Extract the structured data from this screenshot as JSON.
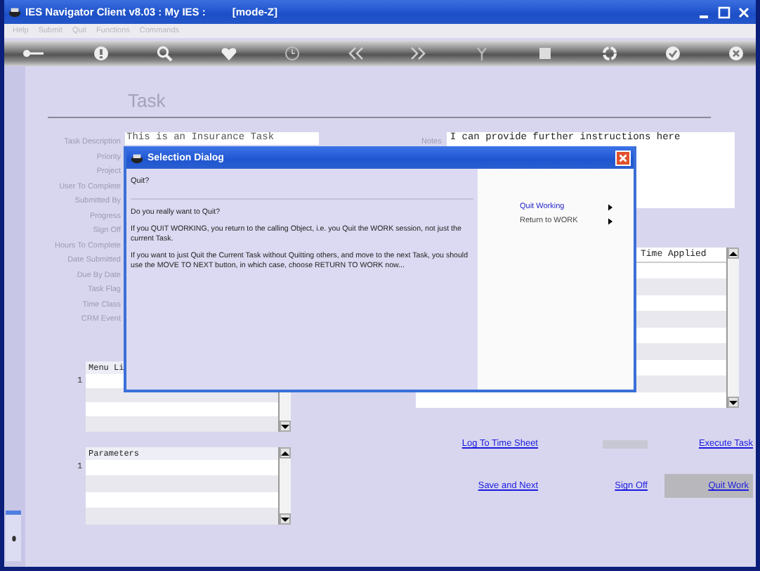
{
  "window": {
    "title": "IES Navigator Client v8.03 : My IES :",
    "mode": "[mode-Z]"
  },
  "menu": [
    {
      "label": "Help"
    },
    {
      "label": "Submit"
    },
    {
      "label": "Quit"
    },
    {
      "label": "Functions"
    },
    {
      "label": "Commands"
    }
  ],
  "form": {
    "heading": "Task",
    "fields": [
      {
        "label": "Task Description",
        "value": "This is an Insurance Task"
      },
      {
        "label": "Priority"
      },
      {
        "label": "Project"
      },
      {
        "label": "User To Complete"
      },
      {
        "label": "Submitted By"
      },
      {
        "label": "Progress"
      },
      {
        "label": "Sign Off"
      },
      {
        "label": "Hours To Complete"
      },
      {
        "label": "Date Submitted"
      },
      {
        "label": "Due By Date"
      },
      {
        "label": "Task Flag"
      },
      {
        "label": "Time Class"
      },
      {
        "label": "CRM Event"
      }
    ],
    "notes": {
      "label": "Notes",
      "value": "I can provide further instructions here"
    },
    "time_table": {
      "column": "Time Applied"
    },
    "menu_list": {
      "header": "Menu Li",
      "row_number": "1"
    },
    "parameters": {
      "header": "Parameters",
      "row_number": "1"
    },
    "actions": [
      [
        {
          "kind": "link",
          "label": "Log To Time Sheet",
          "disabled": false
        },
        {
          "kind": "link",
          "disabled": true
        },
        {
          "kind": "link",
          "label": "Execute Task",
          "disabled": false
        }
      ],
      [
        {
          "kind": "link",
          "label": "Save and Next",
          "disabled": false
        },
        {
          "kind": "link",
          "label": "Sign Off",
          "disabled": false
        },
        {
          "kind": "button",
          "label": "Quit Work",
          "disabled": false
        }
      ]
    ]
  },
  "dialog": {
    "title": "Selection Dialog",
    "prompt": "Quit?",
    "paragraphs": [
      "Do you really want to Quit?",
      "If you QUIT WORKING, you return to the calling Object, i.e. you Quit the WORK session, not just the current Task.",
      "If you want to just Quit the Current Task without Quitting others, and move to the next Task, you should use the MOVE TO NEXT button, in which case, choose RETURN TO WORK now..."
    ],
    "options": [
      {
        "label": "Quit Working",
        "selected": true
      },
      {
        "label": "Return to WORK",
        "selected": false
      }
    ]
  }
}
